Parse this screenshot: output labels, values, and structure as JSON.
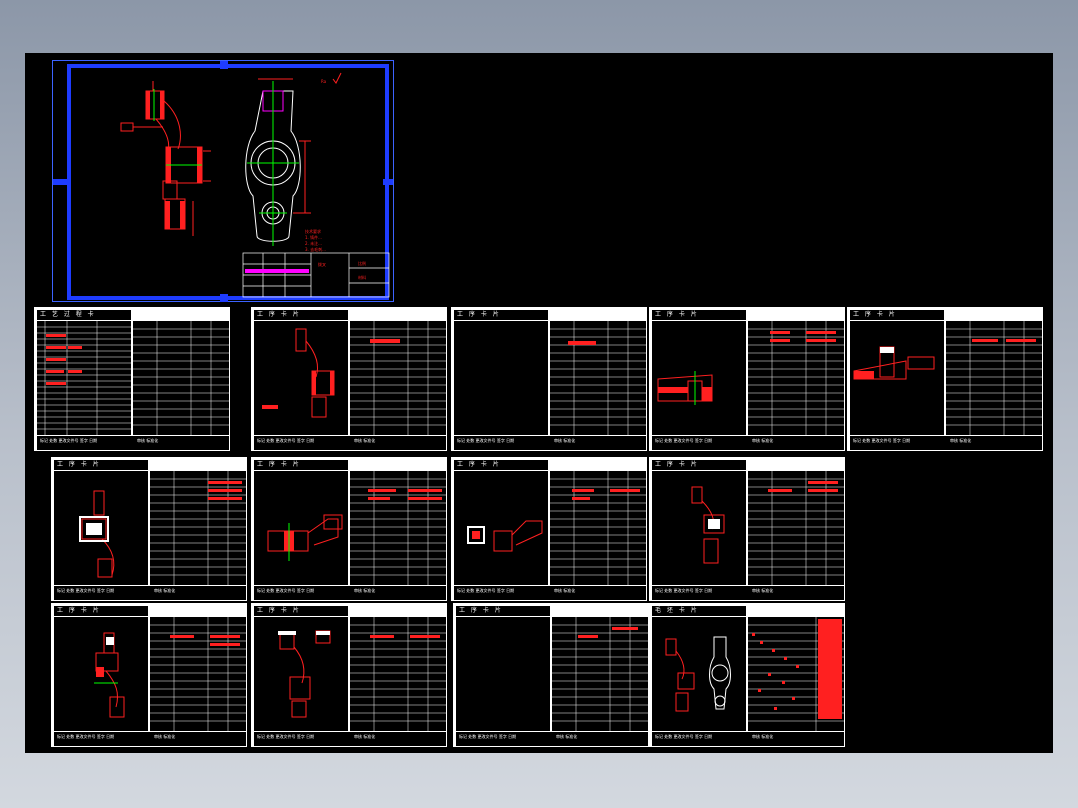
{
  "drawing": {
    "main_sheet": {
      "tech_requirement_label": "技术要求",
      "note_lines": [
        "1. 铸件...",
        "2. 未注...",
        "3. 去毛刺..."
      ],
      "roughness_mark": "Ra",
      "title_block": [
        "拨叉",
        "比例",
        "材料"
      ]
    },
    "process_cards": [
      {
        "caption": "工 艺 过 程 卡",
        "footer_left": "标记 处数 更改文件号 签字 日期",
        "footer_right": "审核 标准化"
      },
      {
        "caption": "工 序 卡 片",
        "footer_left": "标记 处数 更改文件号 签字 日期",
        "footer_right": "审核 标准化"
      },
      {
        "caption": "工 序 卡 片",
        "footer_left": "标记 处数 更改文件号 签字 日期",
        "footer_right": "审核 标准化"
      },
      {
        "caption": "工 序 卡 片",
        "footer_left": "标记 处数 更改文件号 签字 日期",
        "footer_right": "审核 标准化"
      },
      {
        "caption": "工 序 卡 片",
        "footer_left": "标记 处数 更改文件号 签字 日期",
        "footer_right": "审核 标准化"
      },
      {
        "caption": "工 序 卡 片",
        "footer_left": "标记 处数 更改文件号 签字 日期",
        "footer_right": "审核 标准化"
      },
      {
        "caption": "工 序 卡 片",
        "footer_left": "标记 处数 更改文件号 签字 日期",
        "footer_right": "审核 标准化"
      },
      {
        "caption": "工 序 卡 片",
        "footer_left": "标记 处数 更改文件号 签字 日期",
        "footer_right": "审核 标准化"
      },
      {
        "caption": "工 序 卡 片",
        "footer_left": "标记 处数 更改文件号 签字 日期",
        "footer_right": "审核 标准化"
      },
      {
        "caption": "工 序 卡 片",
        "footer_left": "标记 处数 更改文件号 签字 日期",
        "footer_right": "审核 标准化"
      },
      {
        "caption": "工 序 卡 片",
        "footer_left": "标记 处数 更改文件号 签字 日期",
        "footer_right": "审核 标准化"
      },
      {
        "caption": "工 序 卡 片",
        "footer_left": "标记 处数 更改文件号 签字 日期",
        "footer_right": "审核 标准化"
      },
      {
        "caption": "毛 坯 卡 片",
        "footer_left": "标记 处数 更改文件号 签字 日期",
        "footer_right": "审核 标准化"
      }
    ]
  },
  "colors": {
    "background": "#000000",
    "frame": "#1e3cff",
    "geometry": "#ff2020",
    "cards": "#ffffff",
    "centerline": "#00ff00",
    "hatch": "#ff00ff"
  }
}
